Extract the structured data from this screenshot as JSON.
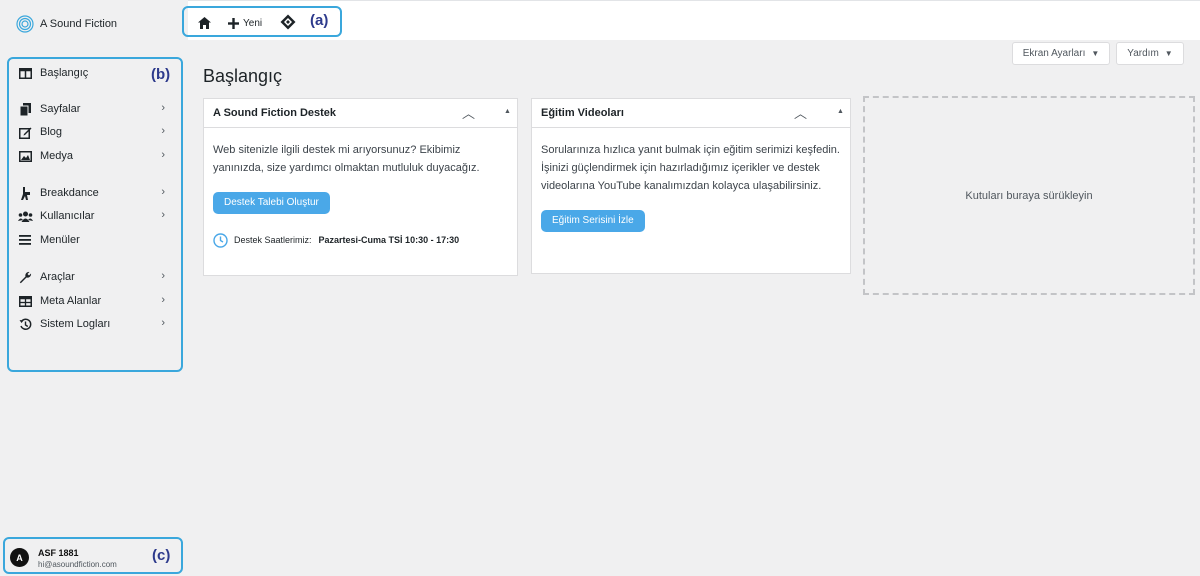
{
  "brand": {
    "name": "A Sound Fiction"
  },
  "topbar": {
    "home_icon": "home-icon",
    "new_label": "Yeni",
    "breakdance_icon": "diamond-icon",
    "annotation": "(a)"
  },
  "sidebar": {
    "annotation": "(b)",
    "items": [
      {
        "label": "Başlangıç",
        "icon": "dashboard-icon",
        "has_chevron": false
      },
      {
        "label": "Sayfalar",
        "icon": "pages-icon",
        "has_chevron": true
      },
      {
        "label": "Blog",
        "icon": "edit-icon",
        "has_chevron": true
      },
      {
        "label": "Medya",
        "icon": "media-icon",
        "has_chevron": true
      },
      {
        "label": "Breakdance",
        "icon": "breakdance-icon",
        "has_chevron": true
      },
      {
        "label": "Kullanıcılar",
        "icon": "users-icon",
        "has_chevron": true
      },
      {
        "label": "Menüler",
        "icon": "menu-icon",
        "has_chevron": false
      },
      {
        "label": "Araçlar",
        "icon": "wrench-icon",
        "has_chevron": true
      },
      {
        "label": "Meta Alanlar",
        "icon": "table-icon",
        "has_chevron": true
      },
      {
        "label": "Sistem Logları",
        "icon": "history-icon",
        "has_chevron": true
      }
    ]
  },
  "user": {
    "annotation": "(c)",
    "initial": "A",
    "name": "ASF 1881",
    "email": "hi@asoundfiction.com"
  },
  "header": {
    "screen_options": "Ekran Ayarları",
    "help": "Yardım",
    "page_title": "Başlangıç"
  },
  "cards": {
    "support": {
      "title": "A Sound Fiction Destek",
      "text": "Web sitenizle ilgili destek mi arıyorsunuz? Ekibimiz yanınızda, size yardımcı olmaktan mutluluk duyacağız.",
      "button": "Destek Talebi Oluştur",
      "hours_label": "Destek Saatlerimiz:",
      "hours_value": "Pazartesi-Cuma TSİ 10:30 - 17:30"
    },
    "videos": {
      "title": "Eğitim Videoları",
      "text": "Sorularınıza hızlıca yanıt bulmak için eğitim serimizi keşfedin. İşinizi güçlendirmek için hazırladığımız içerikler ve destek videolarına YouTube kanalımızdan kolayca ulaşabilirsiniz.",
      "button": "Eğitim Serisini İzle"
    }
  },
  "drop_zone": {
    "text": "Kutuları buraya sürükleyin"
  },
  "colors": {
    "accent": "#4aa8e8",
    "annotation_border": "#3aa7dc",
    "annotation_text": "#2d3a8c"
  }
}
